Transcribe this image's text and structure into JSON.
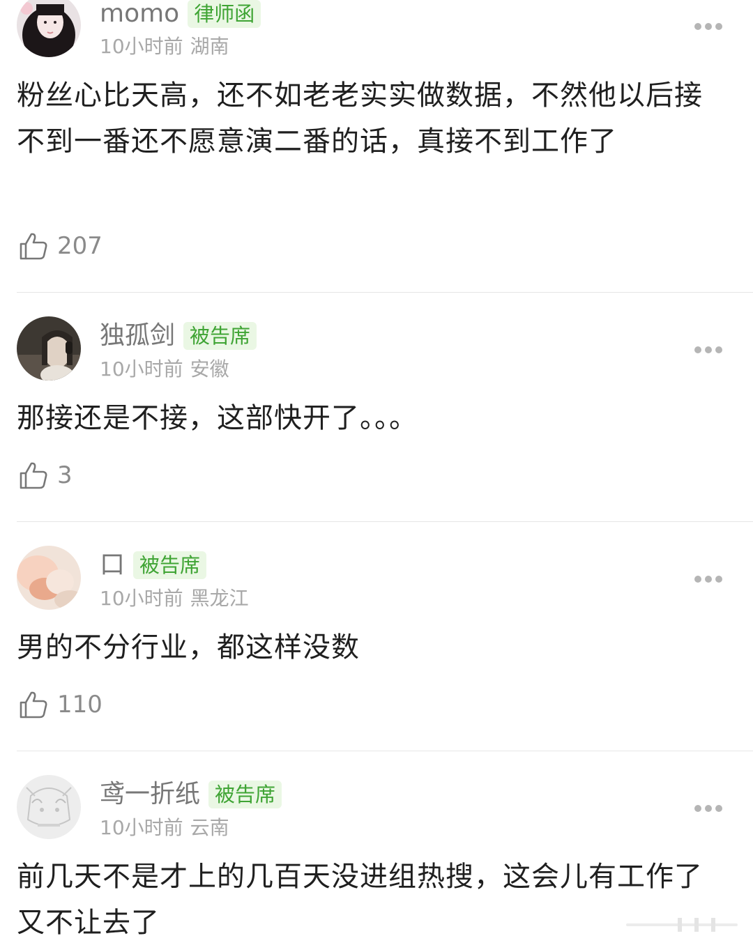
{
  "comments": [
    {
      "username": "momo",
      "badge": "律师函",
      "time": "10小时前",
      "location": "湖南",
      "text": "粉丝心比天高，还不如老老实实做数据，不然他以后接不到一番还不愿意演二番的话，真接不到工作了",
      "likes": "207",
      "avatar_icon": "avatar-girl-photo"
    },
    {
      "username": "独孤剑",
      "badge": "被告席",
      "time": "10小时前",
      "location": "安徽",
      "text": "那接还是不接，这部快开了。。。",
      "likes": "3",
      "avatar_icon": "avatar-headphones-photo"
    },
    {
      "username": "口",
      "badge": "被告席",
      "time": "10小时前",
      "location": "黑龙江",
      "text": "男的不分行业，都这样没数",
      "likes": "110",
      "avatar_icon": "avatar-hand-photo"
    },
    {
      "username": "鸢一折纸",
      "badge": "被告席",
      "time": "10小时前",
      "location": "云南",
      "text": "前几天不是才上的几百天没进组热搜，这会儿有工作了又不让去了",
      "likes": "",
      "avatar_icon": "avatar-anime-sketch"
    }
  ],
  "icons": {
    "like": "thumbs-up-icon",
    "more": "more-dots-icon"
  },
  "colors": {
    "badge_bg": "#eaf7e4",
    "badge_text": "#3fa434",
    "meta_text": "#a8a8a8",
    "username_text": "#777777",
    "divider": "#e6e6e6"
  }
}
